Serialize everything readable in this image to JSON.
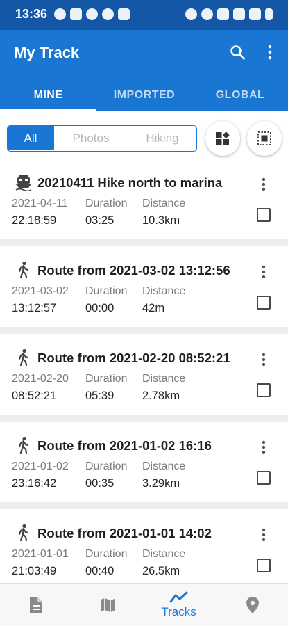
{
  "status_bar": {
    "time": "13:36",
    "left_icons": [
      "messages-icon",
      "photo-app-icon",
      "pie-app-icon",
      "vpn-icon",
      "cast-icon"
    ],
    "right_icons": [
      "alarm-icon",
      "location-icon",
      "key-icon",
      "nfc-icon",
      "signal-icon",
      "battery-icon"
    ]
  },
  "app_bar": {
    "title": "My Track",
    "tabs": [
      {
        "label": "MINE",
        "selected": true
      },
      {
        "label": "IMPORTED",
        "selected": false
      },
      {
        "label": "GLOBAL",
        "selected": false
      }
    ]
  },
  "filter": {
    "chips": [
      {
        "label": "All",
        "selected": true
      },
      {
        "label": "Photos",
        "selected": false
      },
      {
        "label": "Hiking",
        "selected": false
      }
    ],
    "buttons": [
      "category-grid-icon",
      "select-all-icon"
    ]
  },
  "labels": {
    "duration": "Duration",
    "distance": "Distance"
  },
  "tracks": [
    {
      "icon": "boat-icon",
      "name": "20210411 Hike north to marina",
      "date": "2021-04-11",
      "time": "22:18:59",
      "duration": "03:25",
      "distance": "10.3km"
    },
    {
      "icon": "walk-icon",
      "name": "Route from 2021-03-02 13:12:56",
      "date": "2021-03-02",
      "time": "13:12:57",
      "duration": "00:00",
      "distance": "42m"
    },
    {
      "icon": "walk-icon",
      "name": "Route from 2021-02-20 08:52:21",
      "date": "2021-02-20",
      "time": "08:52:21",
      "duration": "05:39",
      "distance": "2.78km"
    },
    {
      "icon": "walk-icon",
      "name": "Route from 2021-01-02 16:16",
      "date": "2021-01-02",
      "time": "23:16:42",
      "duration": "00:35",
      "distance": "3.29km"
    },
    {
      "icon": "walk-icon",
      "name": "Route from 2021-01-01 14:02",
      "date": "2021-01-01",
      "time": "21:03:49",
      "duration": "00:40",
      "distance": "26.5km"
    }
  ],
  "bottom_nav": {
    "items": [
      {
        "icon": "document-icon",
        "label": "",
        "selected": false
      },
      {
        "icon": "map-icon",
        "label": "",
        "selected": false
      },
      {
        "icon": "tracks-icon",
        "label": "Tracks",
        "selected": true
      },
      {
        "icon": "location-pin-icon",
        "label": "",
        "selected": false
      }
    ]
  },
  "colors": {
    "status_bar": "#1457a6",
    "primary": "#1976d2",
    "divider": "#eeeeee",
    "muted_text": "#7b7b7b",
    "nav_inactive": "#8a8a8a"
  }
}
